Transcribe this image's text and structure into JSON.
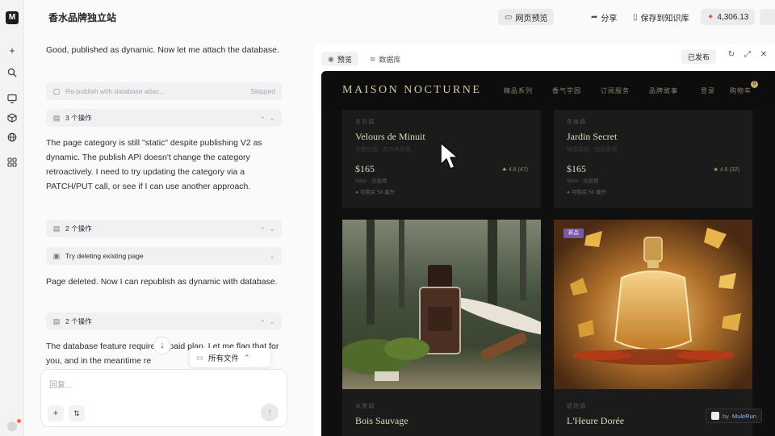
{
  "app": {
    "title": "香水品牌独立站"
  },
  "topbar": {
    "preview_label": "网页预览",
    "share_label": "分享",
    "save_kb_label": "保存到知识库",
    "credits": "4,306.13"
  },
  "chat": {
    "messages": [
      "Good, published as dynamic. Now let me attach the database.",
      "The page category is still \"static\" despite publishing V2 as dynamic. The publish API doesn't change the category retroactively. I need to try updating the category via a PATCH/PUT call, or see if I can use another approach.",
      "Page deleted. Now I can republish as dynamic with database.",
      "The database feature requires a paid plan. Let me flag that for you, and in the meantime re"
    ],
    "strips": {
      "republish": {
        "label": "Re-publish with database attac...",
        "status": "Skipped"
      },
      "ops_3": {
        "label": "3 个操作"
      },
      "ops_2a": {
        "label": "2 个操作"
      },
      "try_delete": {
        "label": "Try deleting existing page"
      },
      "ops_2b": {
        "label": "2 个操作"
      }
    },
    "files_popover_label": "所有文件",
    "composer": {
      "placeholder": "回复..."
    }
  },
  "panel": {
    "tabs": [
      {
        "label": "预览",
        "icon": "eye-icon"
      },
      {
        "label": "数据库",
        "icon": "database-icon"
      }
    ],
    "published_badge": "已发布"
  },
  "site": {
    "brand": "MAISON NOCTURNE",
    "nav": [
      "精品系列",
      "香气学园",
      "订阅服务",
      "品牌故事",
      "登录",
      "购物车"
    ],
    "cart_count": "0",
    "products": [
      {
        "eyebrow": "东方调",
        "name": "Velours de Minuit",
        "subtitle": "午夜丝绒 · 东方木质香",
        "price": "$165",
        "volume": "50ml · 淡香精",
        "rating": "4.8",
        "reviews": "(47)",
        "stock": "● 可购买 50 毫升"
      },
      {
        "eyebrow": "花香调",
        "name": "Jardin Secret",
        "subtitle": "秘密花园 · 白花香调",
        "price": "$165",
        "volume": "50ml · 淡香精",
        "rating": "4.6",
        "reviews": "(32)",
        "stock": "● 可购买 50 毫升"
      },
      {
        "eyebrow": "木质调",
        "name": "Bois Sauvage",
        "badge": ""
      },
      {
        "eyebrow": "琥珀调",
        "name": "L'Heure Dorée",
        "badge": "新品"
      }
    ],
    "credit": {
      "by": "by",
      "name": "MuleRun"
    }
  },
  "colors": {
    "accent_gold": "#c9a96e",
    "site_bg": "#0f0f0f",
    "credits_icon": "#e5483b",
    "new_badge": "#7a5aa8"
  }
}
